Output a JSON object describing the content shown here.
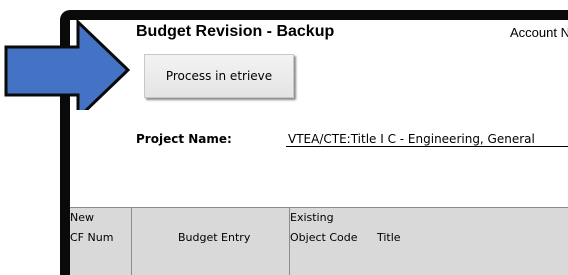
{
  "sheet": {
    "title": "Budget Revision - Backup",
    "account_label": "Account N"
  },
  "actions": {
    "process_label": "Process in etrieve"
  },
  "project": {
    "label": "Project Name:",
    "value": "VTEA/CTE:Title I C - Engineering, General"
  },
  "table_header": {
    "col_new_line1": "New",
    "col_new_line2": "CF Num",
    "col_budget_entry": "Budget Entry",
    "col_existing_line1": "Existing",
    "col_object_code": "Object Code",
    "col_title": "Title"
  },
  "colors": {
    "frame": "#0a0a0a",
    "arrow_fill": "#4472c4",
    "header_fill": "#d9d9d9"
  },
  "icons": {
    "pointer": "right-arrow-icon"
  }
}
